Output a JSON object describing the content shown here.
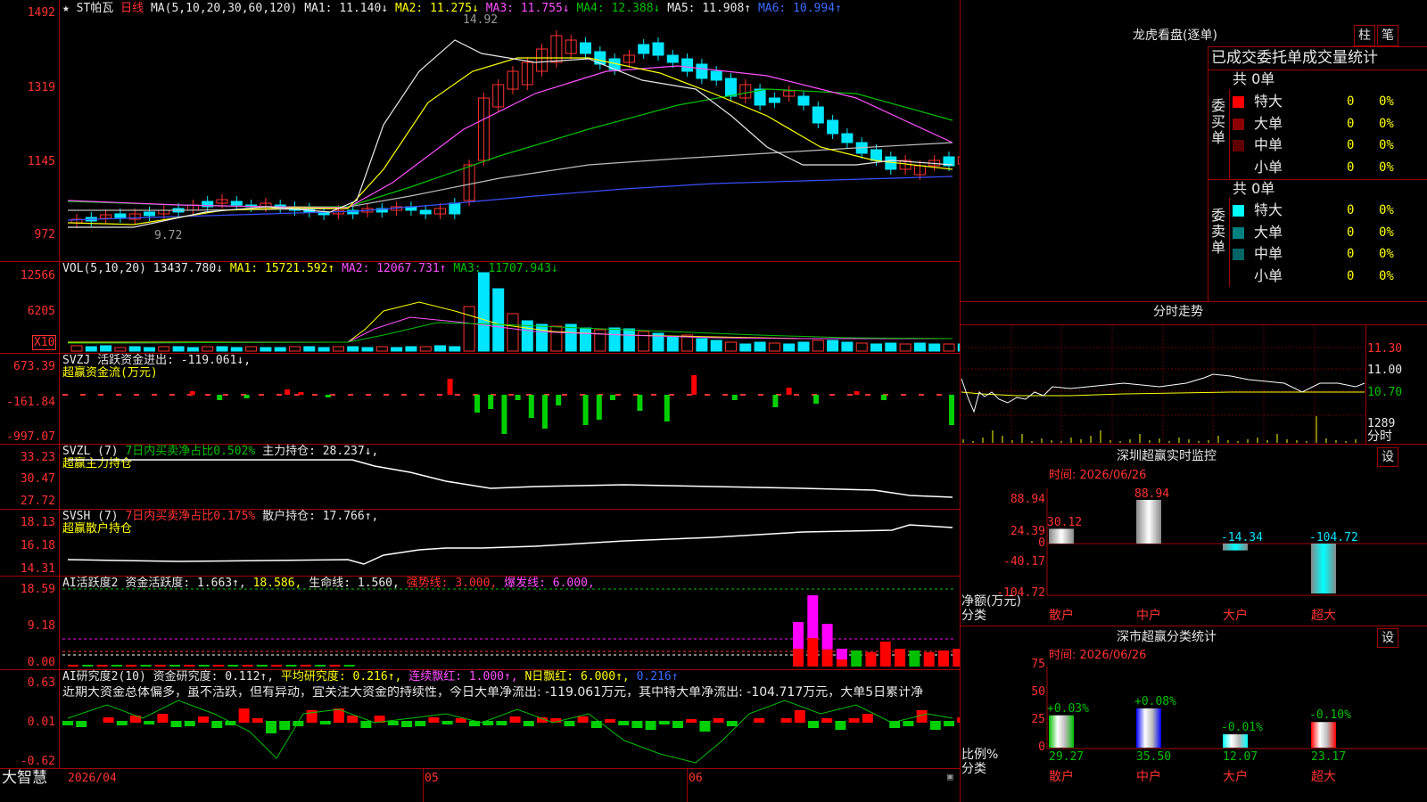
{
  "main": {
    "name": "ST帕瓦",
    "period": "日线",
    "ma_label": "MA(5,10,20,30,60,120)",
    "ma": [
      {
        "label": "MA1: 11.140↓",
        "color": "#e8e8e8"
      },
      {
        "label": "MA2: 11.275↓",
        "color": "#ffff00"
      },
      {
        "label": "MA3: 11.755↓",
        "color": "#ff50ff"
      },
      {
        "label": "MA4: 12.388↓",
        "color": "#00c000"
      },
      {
        "label": "MA5: 11.908↑",
        "color": "#c0c0c0"
      },
      {
        "label": "MA6: 10.994↑",
        "color": "#3b6bff"
      }
    ],
    "y_ticks": [
      "1492",
      "1319",
      "1145",
      "972"
    ],
    "high_note": "14.92",
    "low_note": "9.72"
  },
  "vol": {
    "label": "VOL(5,10,20)",
    "value": "13437.780↓",
    "ma1": "MA1: 15721.592↑",
    "ma2": "MA2: 12067.731↑",
    "ma3": "MA3: 11707.943↓",
    "y_ticks": [
      "12566",
      "6205"
    ],
    "unit": "X10"
  },
  "svzj": {
    "label": "SVZJ",
    "desc": "活跃资金进出: -119.061↓,",
    "sub": "超赢资金流(万元)",
    "y_ticks": [
      "673.39",
      "-161.84",
      "-997.07"
    ]
  },
  "svzl": {
    "label": "SVZL (7)",
    "desc1": "7日内买卖净占比0.502%",
    "desc2": "主力持仓: 28.237↓,",
    "sub": "超赢主力持仓",
    "y_ticks": [
      "33.23",
      "30.47",
      "27.72"
    ]
  },
  "svsh": {
    "label": "SVSH (7)",
    "desc1": "7日内买卖净占比0.175%",
    "desc2": "散户持仓: 17.766↑,",
    "sub": "超赢散户持仓",
    "y_ticks": [
      "18.13",
      "16.18",
      "14.31"
    ]
  },
  "ai_active": {
    "label": "AI活跃度2",
    "desc": "资金活跃度: 1.663↑,",
    "v2": "18.586,",
    "life": "生命线: 1.560,",
    "strong": "强势线: 3.000,",
    "burst": "爆发线: 6.000,",
    "y_ticks": [
      "18.59",
      "9.18",
      "0.00"
    ]
  },
  "ai_research": {
    "label": "AI研究度2(10)",
    "desc": "资金研究度: 0.112↑,",
    "avg": "平均研究度: 0.216↑,",
    "cont": "连续飘红: 1.000↑,",
    "nday": "N日飘红: 6.000↑,",
    "last": "0.216↑",
    "note": "近期大资金总体偏多，虽不活跃，但有异动，宜关注大资金的持续性，今日大单净流出: -119.061万元，其中特大单净流出: -104.717万元，大单5日累计净",
    "y_ticks": [
      "0.63",
      "0.01",
      "-0.62"
    ]
  },
  "footer": {
    "brand": "大智慧",
    "date": "2026/04",
    "m5": "05",
    "m6": "06"
  },
  "right": {
    "title": "龙虎看盘(逐单)",
    "btn_zhu": "柱",
    "btn_bi": "笔",
    "stats_title": "已成交委托单成交量统计",
    "buy_total": "共 0单",
    "buy_side": "委买单",
    "sell_total": "共 0单",
    "sell_side": "委卖单",
    "buy_rows": [
      {
        "label": "特大",
        "vol": "0",
        "pct": "0%",
        "color": "#ff0000"
      },
      {
        "label": "大单",
        "vol": "0",
        "pct": "0%",
        "color": "#8b0000"
      },
      {
        "label": "中单",
        "vol": "0",
        "pct": "0%",
        "color": "#600000"
      },
      {
        "label": "小单",
        "vol": "0",
        "pct": "0%",
        "color": ""
      }
    ],
    "sell_rows": [
      {
        "label": "特大",
        "vol": "0",
        "pct": "0%",
        "color": "#00ffff"
      },
      {
        "label": "大单",
        "vol": "0",
        "pct": "0%",
        "color": "#008080"
      },
      {
        "label": "中单",
        "vol": "0",
        "pct": "0%",
        "color": "#006666"
      },
      {
        "label": "小单",
        "vol": "0",
        "pct": "0%",
        "color": ""
      }
    ],
    "intraday_title": "分时走势",
    "intraday_ticks": [
      "11.30",
      "11.00",
      "10.70"
    ],
    "intraday_vol": "1289",
    "intraday_vol_unit": "分时",
    "monitor_title": "深圳超赢实时监控",
    "monitor_btn": "设",
    "monitor_time": "时间: 2026/06/26",
    "monitor_ticks": [
      "88.94",
      "24.39",
      "0",
      "-40.17",
      "-104.72"
    ],
    "monitor_ylabel": "净额(万元)",
    "monitor_xlabel": "分类",
    "monitor_bars": [
      {
        "cat": "散户",
        "value": 30.12,
        "label": "30.12",
        "color": "#ffffff"
      },
      {
        "cat": "中户",
        "value": 88.94,
        "label": "88.94",
        "color": "#ffffff"
      },
      {
        "cat": "大户",
        "value": -14.34,
        "label": "-14.34",
        "color": "#00ffff"
      },
      {
        "cat": "超大",
        "value": -104.72,
        "label": "-104.72",
        "color": "#00ffff"
      }
    ],
    "class_title": "深市超赢分类统计",
    "class_btn": "设",
    "class_time": "时间: 2026/06/26",
    "class_ticks": [
      "75",
      "50",
      "25",
      "0"
    ],
    "class_ylabel": "比例%",
    "class_xlabel": "分类",
    "class_bars": [
      {
        "cat": "散户",
        "value": 29.27,
        "label": "29.27",
        "top": "+0.03%",
        "color": "#00c000"
      },
      {
        "cat": "中户",
        "value": 35.5,
        "label": "35.50",
        "top": "+0.08%",
        "color": "#0000ff"
      },
      {
        "cat": "大户",
        "value": 12.07,
        "label": "12.07",
        "top": "-0.01%",
        "color": "#00ffff"
      },
      {
        "cat": "超大",
        "value": 23.17,
        "label": "23.17",
        "top": "-0.10%",
        "color": "#ff0000"
      }
    ]
  },
  "chart_data": {
    "type": "bar",
    "categories": [
      "散户",
      "中户",
      "大户",
      "超大"
    ],
    "series": [
      {
        "name": "净额(万元)",
        "values": [
          30.12,
          88.94,
          -14.34,
          -104.72
        ]
      },
      {
        "name": "比例%",
        "values": [
          29.27,
          35.5,
          12.07,
          23.17
        ]
      }
    ],
    "ylim": [
      -104.72,
      88.94
    ]
  }
}
